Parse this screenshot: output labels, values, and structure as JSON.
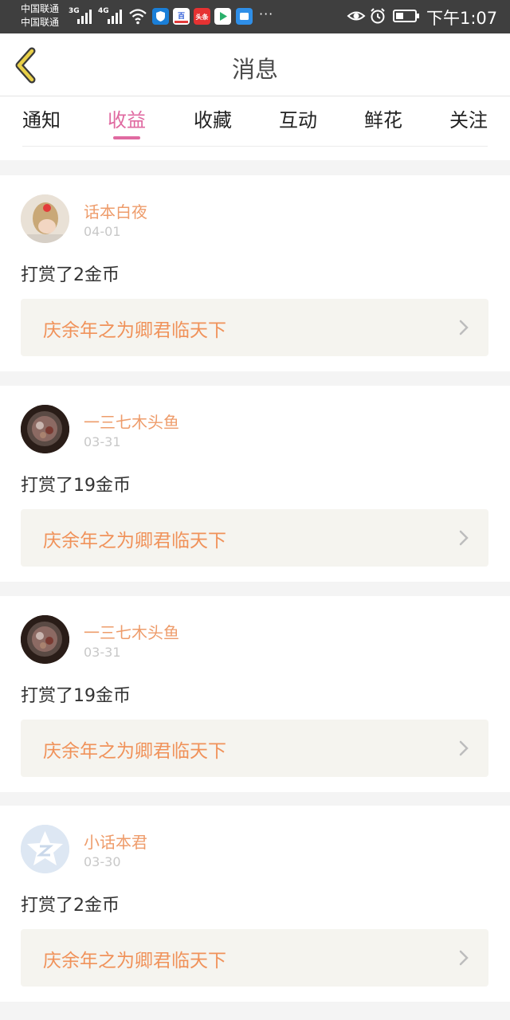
{
  "status_bar": {
    "carrier1": "中国联通",
    "carrier2": "中国联通",
    "net1": "3G",
    "net2": "4G",
    "time": "下午1:07",
    "battery_level": 0.4,
    "icons": [
      "signal-icon",
      "wifi-icon",
      "shield-app-icon",
      "baidu-app-icon",
      "toutiao-app-icon",
      "video-app-icon",
      "wallet-app-icon",
      "more-icon",
      "eye-icon",
      "alarm-icon",
      "battery-icon"
    ],
    "app_labels": {
      "baidu": "百",
      "toutiao": "头条"
    }
  },
  "header": {
    "title": "消息",
    "back_icon": "chevron-left-icon",
    "accent": "#e0c040"
  },
  "tabs": [
    {
      "label": "通知",
      "active": false
    },
    {
      "label": "收益",
      "active": true
    },
    {
      "label": "收藏",
      "active": false
    },
    {
      "label": "互动",
      "active": false
    },
    {
      "label": "鲜花",
      "active": false
    },
    {
      "label": "关注",
      "active": false
    }
  ],
  "colors": {
    "accent": "#e06aa1",
    "name": "#ee9c6b",
    "book": "#f0925a",
    "book_bg": "#f5f4ef"
  },
  "items": [
    {
      "name": "话本白夜",
      "date": "04-01",
      "message": "打赏了2金币",
      "book": "庆余年之为卿君临天下",
      "avatar": "girl-photo"
    },
    {
      "name": "一三七木头鱼",
      "date": "03-31",
      "message": "打赏了19金币",
      "book": "庆余年之为卿君临天下",
      "avatar": "food-photo"
    },
    {
      "name": "一三七木头鱼",
      "date": "03-31",
      "message": "打赏了19金币",
      "book": "庆余年之为卿君临天下",
      "avatar": "food-photo"
    },
    {
      "name": "小话本君",
      "date": "03-30",
      "message": "打赏了2金币",
      "book": "庆余年之为卿君临天下",
      "avatar": "default-star-avatar"
    }
  ]
}
